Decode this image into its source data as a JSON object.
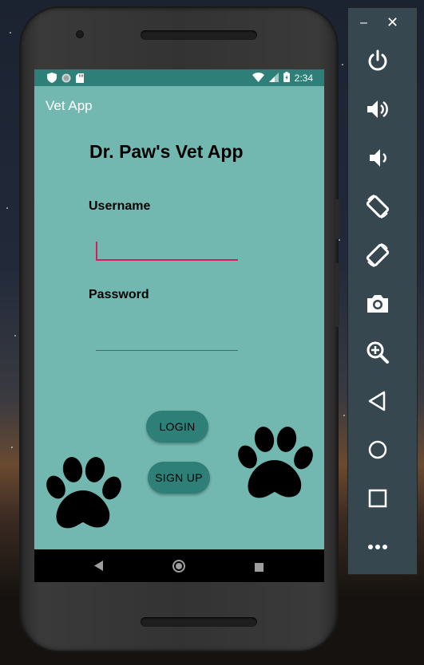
{
  "status_bar": {
    "time": "2:34",
    "left_icons": [
      "shield-icon",
      "circle-icon",
      "sd-card-icon"
    ],
    "right_icons": [
      "wifi-icon",
      "signal-icon",
      "battery-icon"
    ]
  },
  "app_bar": {
    "title": "Vet App"
  },
  "login_form": {
    "heading": "Dr. Paw's Vet App",
    "username_label": "Username",
    "username_value": "",
    "password_label": "Password",
    "password_value": "",
    "login_button": "LOGIN",
    "signup_button": "SIGN UP"
  },
  "nav_bar": {
    "icons": [
      "back-icon",
      "home-icon",
      "recents-icon"
    ]
  },
  "emulator_panel": {
    "minimize_label": "–",
    "close_label": "✕",
    "controls": [
      "power-icon",
      "volume-up-icon",
      "volume-down-icon",
      "rotate-left-icon",
      "rotate-right-icon",
      "camera-icon",
      "zoom-icon",
      "back-icon",
      "home-icon",
      "overview-icon",
      "more-icon"
    ]
  },
  "colors": {
    "status_bar": "#2e7f77",
    "background": "#73b8b0",
    "button": "#2e7f77",
    "focus_accent": "#d81b60",
    "emulator_panel": "#37474f"
  }
}
